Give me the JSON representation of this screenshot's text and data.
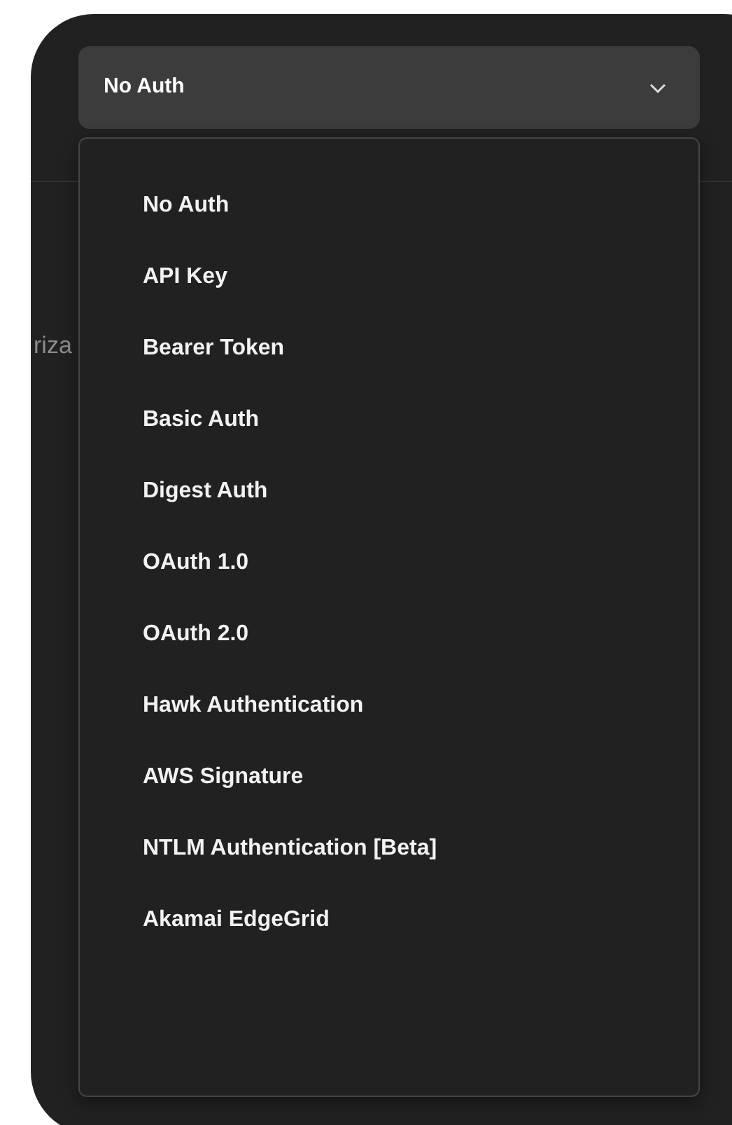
{
  "auth_type_select": {
    "value": "No Auth",
    "expanded": true
  },
  "background_text": "riza",
  "menu_items": [
    "No Auth",
    "API Key",
    "Bearer Token",
    "Basic Auth",
    "Digest Auth",
    "OAuth 1.0",
    "OAuth 2.0",
    "Hawk Authentication",
    "AWS Signature",
    "NTLM Authentication [Beta]",
    "Akamai EdgeGrid"
  ]
}
